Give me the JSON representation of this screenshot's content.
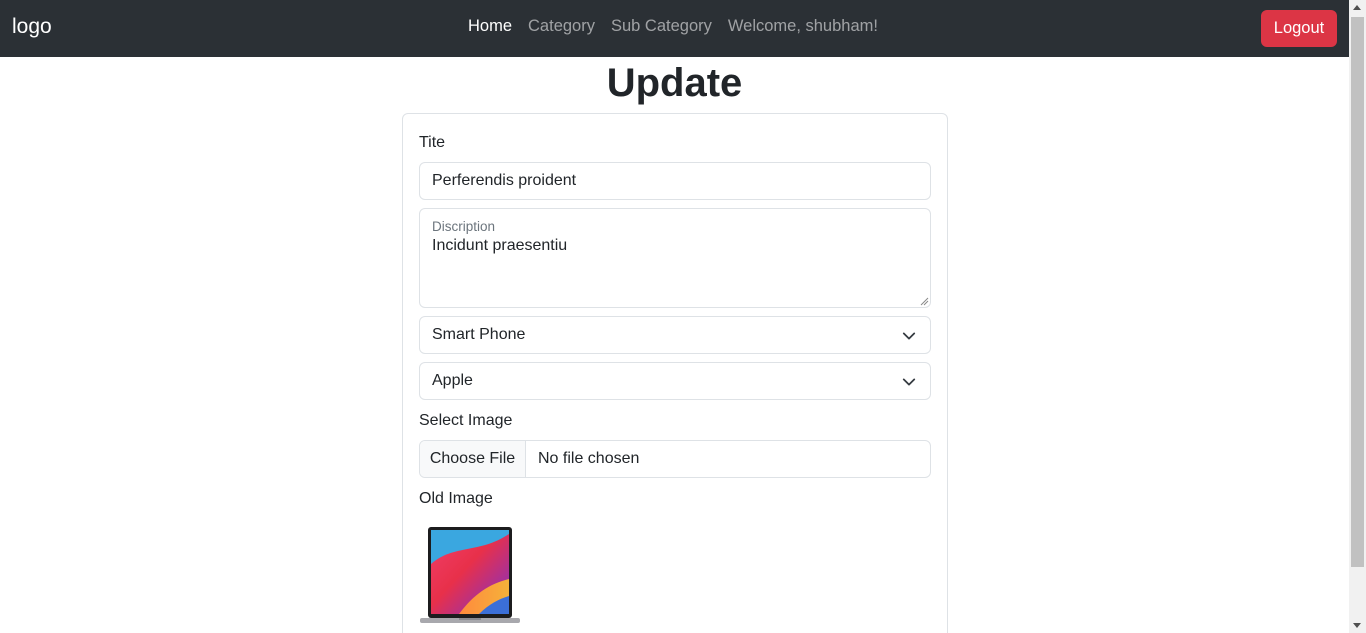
{
  "navbar": {
    "brand": "logo",
    "links": [
      {
        "label": "Home",
        "active": true
      },
      {
        "label": "Category",
        "active": false
      },
      {
        "label": "Sub Category",
        "active": false
      }
    ],
    "welcome": "Welcome, shubham!",
    "logout_label": "Logout"
  },
  "page": {
    "title": "Update"
  },
  "form": {
    "title_label": "Tite",
    "title_value": "Perferendis proident",
    "description_label": "Discription",
    "description_value": "Incidunt praesentiu",
    "category_selected": "Smart Phone",
    "subcategory_selected": "Apple",
    "image_label": "Select Image",
    "file_button": "Choose File",
    "file_status": "No file chosen",
    "old_image_label": "Old Image"
  },
  "colors": {
    "navbar_bg": "#2b3035",
    "logout_bg": "#dc3545",
    "border": "#dee2e6"
  }
}
